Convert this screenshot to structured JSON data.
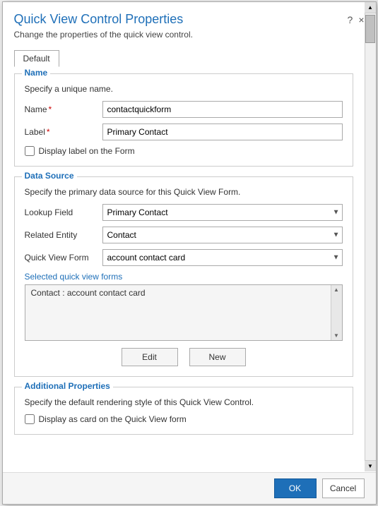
{
  "dialog": {
    "title": "Quick View Control Properties",
    "subtitle": "Change the properties of the quick view control.",
    "help_icon": "?",
    "close_icon": "×"
  },
  "tabs": [
    {
      "label": "Default",
      "active": true
    }
  ],
  "name_section": {
    "legend": "Name",
    "description": "Specify a unique name.",
    "name_label": "Name",
    "name_required": true,
    "name_value": "contactquickform",
    "label_label": "Label",
    "label_required": true,
    "label_value": "Primary Contact",
    "checkbox_label": "Display label on the Form",
    "checkbox_checked": false
  },
  "datasource_section": {
    "legend": "Data Source",
    "description": "Specify the primary data source for this Quick View Form.",
    "lookup_field_label": "Lookup Field",
    "lookup_field_value": "Primary Contact",
    "lookup_field_options": [
      "Primary Contact"
    ],
    "related_entity_label": "Related Entity",
    "related_entity_value": "Contact",
    "related_entity_options": [
      "Contact"
    ],
    "quick_view_form_label": "Quick View Form",
    "quick_view_form_value": "account contact card",
    "quick_view_form_options": [
      "account contact card"
    ],
    "selected_label": "Selected quick view forms",
    "listbox_item": "Contact : account contact card",
    "edit_button": "Edit",
    "new_button": "New"
  },
  "additional_section": {
    "legend": "Additional Properties",
    "description": "Specify the default rendering style of this Quick View Control.",
    "checkbox_label": "Display as card on the Quick View form",
    "checkbox_checked": false
  },
  "footer": {
    "ok_label": "OK",
    "cancel_label": "Cancel"
  }
}
